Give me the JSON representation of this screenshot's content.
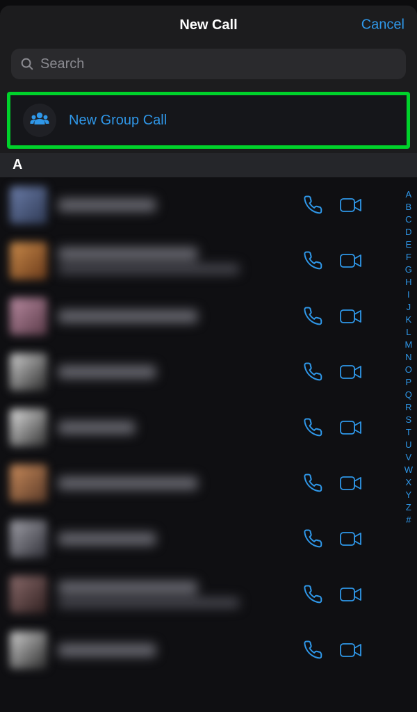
{
  "header": {
    "title": "New Call",
    "cancel": "Cancel"
  },
  "search": {
    "placeholder": "Search"
  },
  "group_call": {
    "label": "New Group Call"
  },
  "section": {
    "letter": "A"
  },
  "contacts": [
    {
      "avatar_class": "c1",
      "lines": 1,
      "w": "w1"
    },
    {
      "avatar_class": "c2",
      "lines": 2,
      "w": "w2"
    },
    {
      "avatar_class": "c3",
      "lines": 1,
      "w": "w2"
    },
    {
      "avatar_class": "c4",
      "lines": 1,
      "w": "w1"
    },
    {
      "avatar_class": "c5",
      "lines": 1,
      "w": "w3"
    },
    {
      "avatar_class": "c6",
      "lines": 1,
      "w": "w2"
    },
    {
      "avatar_class": "c7",
      "lines": 1,
      "w": "w1"
    },
    {
      "avatar_class": "c8",
      "lines": 2,
      "w": "w2"
    },
    {
      "avatar_class": "c9",
      "lines": 1,
      "w": "w1"
    }
  ],
  "index": [
    "A",
    "B",
    "C",
    "D",
    "E",
    "F",
    "G",
    "H",
    "I",
    "J",
    "K",
    "L",
    "M",
    "N",
    "O",
    "P",
    "Q",
    "R",
    "S",
    "T",
    "U",
    "V",
    "W",
    "X",
    "Y",
    "Z",
    "#"
  ],
  "colors": {
    "accent": "#2f97e8",
    "highlight_border": "#00d22b",
    "background": "#1c1c1e"
  }
}
